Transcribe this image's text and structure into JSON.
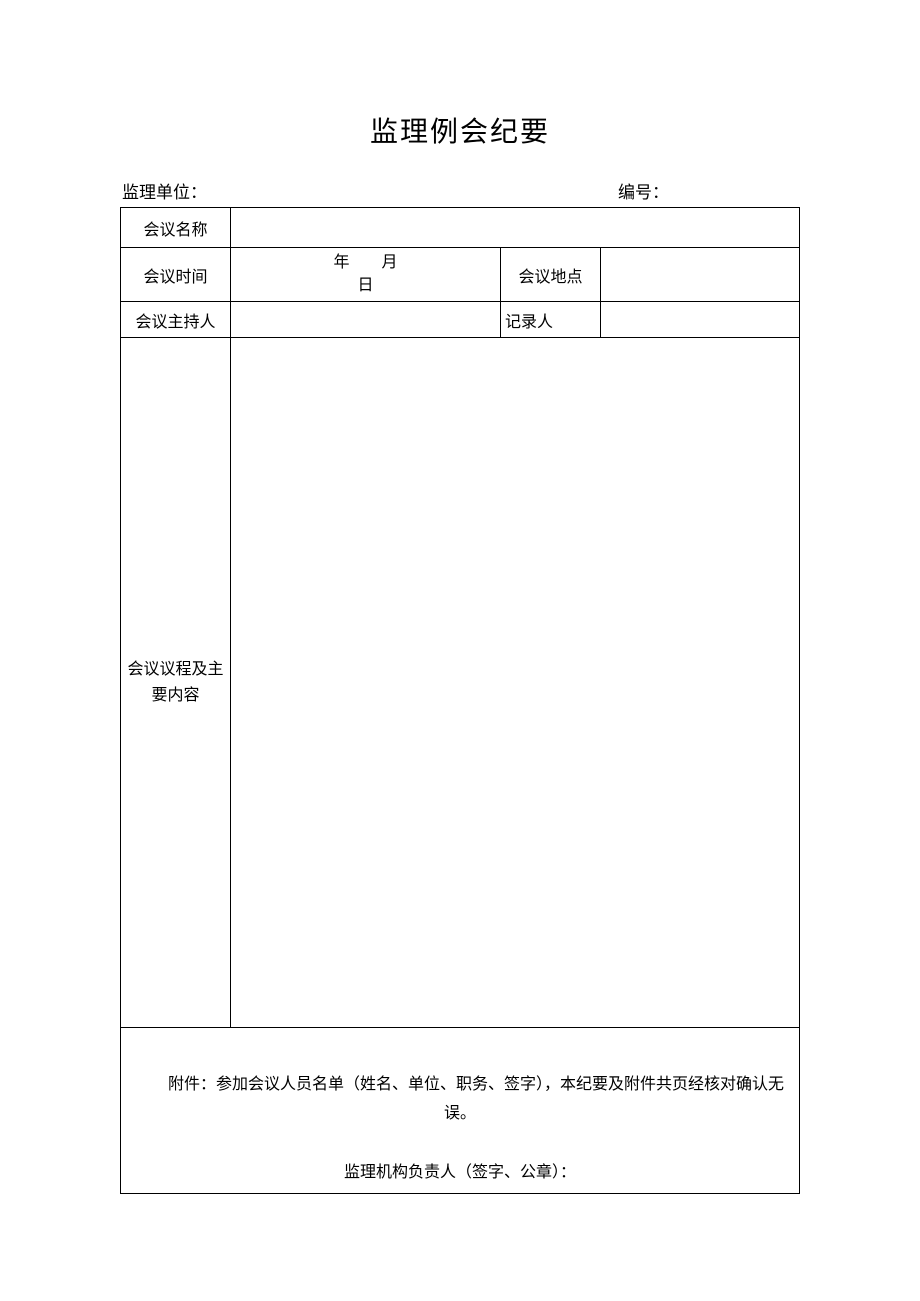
{
  "title": "监理例会纪要",
  "header": {
    "org_label": "监理单位：",
    "number_label": "编号："
  },
  "rows": {
    "meeting_name_label": "会议名称",
    "meeting_name_value": "",
    "meeting_time_label": "会议时间",
    "date_line1": "年  月",
    "date_line2": "日",
    "meeting_place_label": "会议地点",
    "meeting_place_value": "",
    "host_label": "会议主持人",
    "host_value": "",
    "recorder_label": "记录人",
    "recorder_value": "",
    "agenda_label_line1": "会议议程及主",
    "agenda_label_line2": "要内容",
    "agenda_value": ""
  },
  "footer": {
    "attachment_line": "附件：参加会议人员名单（姓名、单位、职务、签字），本纪要及附件共页经核对确认无",
    "attachment_end": "误。",
    "sign_label": "监理机构负责人（签字、公章）："
  }
}
